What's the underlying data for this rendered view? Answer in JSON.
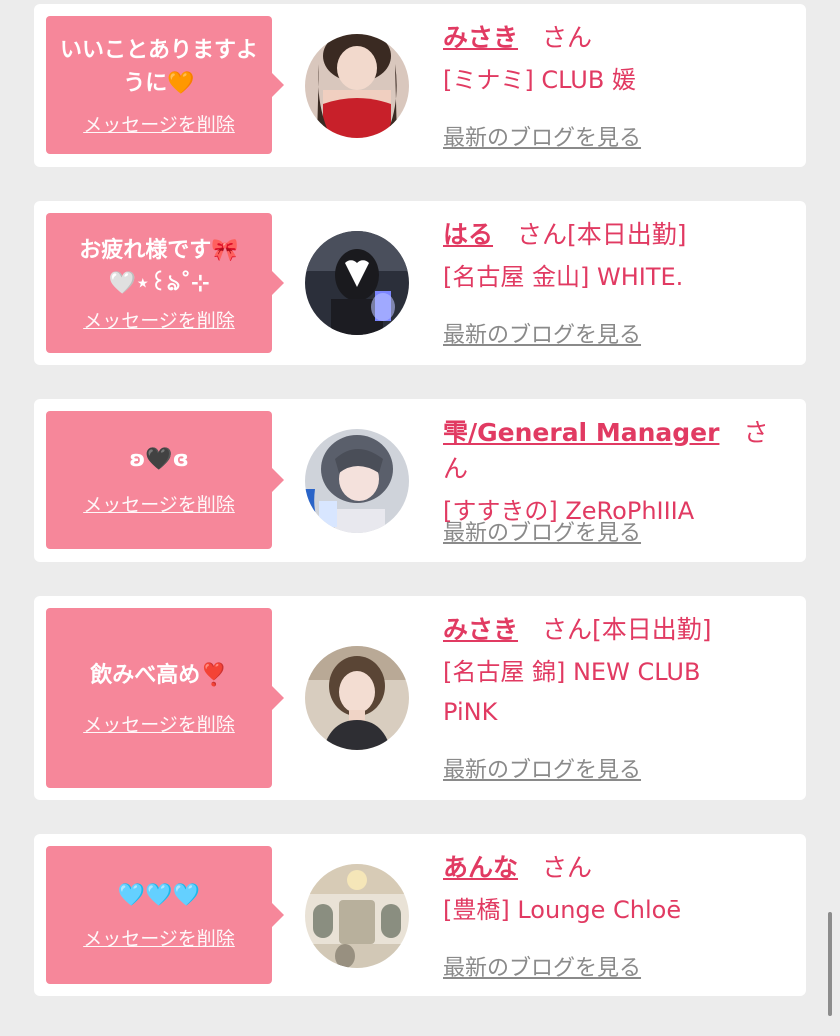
{
  "cards": [
    {
      "message": "いいことありますように🧡",
      "delete_label": "メッセージを削除",
      "name": "みさき",
      "honorific": "さん",
      "status": "",
      "shop": "[ミナミ] CLUB 媛",
      "blog_label": "最新のブログを見る"
    },
    {
      "message": "お疲れ様です🎀\n🤍⋆꒰ঌ˚⊹",
      "delete_label": "メッセージを削除",
      "name": "はる",
      "honorific": "さん",
      "status": "[本日出勤]",
      "shop": "[名古屋 金山] WHITE.",
      "blog_label": "最新のブログを見る"
    },
    {
      "message": "ʚ🖤ɞ",
      "delete_label": "メッセージを削除",
      "name": "雫/General Manager",
      "honorific": "さん",
      "status": "",
      "shop": "[すすきの] ZeRoPhIIIA",
      "blog_label": "最新のブログを見る"
    },
    {
      "message": "飲みべ高め❣️",
      "delete_label": "メッセージを削除",
      "name": "みさき",
      "honorific": "さん",
      "status": "[本日出勤]",
      "shop": "[名古屋 錦] NEW CLUB PiNK",
      "blog_label": "最新のブログを見る"
    },
    {
      "message": "🩵🩵🩵",
      "delete_label": "メッセージを削除",
      "name": "あんな",
      "honorific": "さん",
      "status": "",
      "shop": "[豊橋] Lounge Chloē",
      "blog_label": "最新のブログを見る"
    }
  ],
  "colors": {
    "bubble": "#f6879a",
    "accent": "#e13a62",
    "link_gray": "#8a8a8a",
    "background": "#ececec"
  }
}
